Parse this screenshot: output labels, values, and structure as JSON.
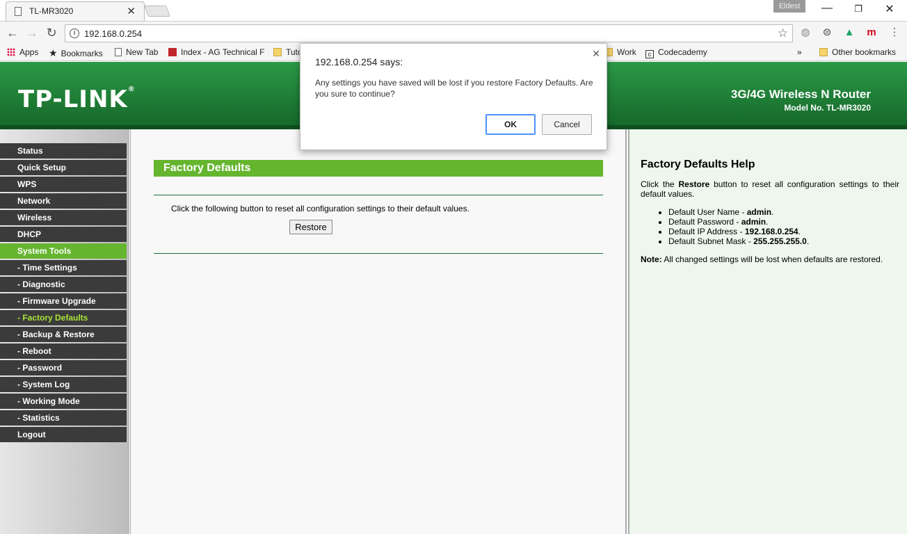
{
  "browser": {
    "tab_title": "TL-MR3020",
    "profile_name": "Eldest",
    "url": "192.168.0.254",
    "bookmarks": [
      {
        "label": "Apps",
        "icon": "apps-grid-icon"
      },
      {
        "label": "Bookmarks",
        "icon": "star-icon"
      },
      {
        "label": "New Tab",
        "icon": "page-icon"
      },
      {
        "label": "Index - AG Technical F",
        "icon": "site-icon"
      },
      {
        "label": "Tuto",
        "icon": "folder-icon"
      },
      {
        "label": "Work",
        "icon": "folder-icon"
      },
      {
        "label": "Codecademy",
        "icon": "codecademy-icon"
      }
    ],
    "overflow_label": "»",
    "other_bookmarks": "Other bookmarks"
  },
  "header": {
    "logo": "TP-LINK",
    "product_name": "3G/4G Wireless N Router",
    "model": "Model No. TL-MR3020"
  },
  "sidebar": {
    "items": [
      {
        "label": "Status"
      },
      {
        "label": "Quick Setup"
      },
      {
        "label": "WPS"
      },
      {
        "label": "Network"
      },
      {
        "label": "Wireless"
      },
      {
        "label": "DHCP"
      },
      {
        "label": "System Tools",
        "state": "active"
      },
      {
        "label": "- Time Settings"
      },
      {
        "label": "- Diagnostic"
      },
      {
        "label": "- Firmware Upgrade"
      },
      {
        "label": "- Factory Defaults",
        "state": "current"
      },
      {
        "label": "- Backup & Restore"
      },
      {
        "label": "- Reboot"
      },
      {
        "label": "- Password"
      },
      {
        "label": "- System Log"
      },
      {
        "label": "- Working Mode"
      },
      {
        "label": "- Statistics"
      },
      {
        "label": "Logout"
      }
    ]
  },
  "main": {
    "title": "Factory Defaults",
    "description": "Click the following button to reset all configuration settings to their default values.",
    "restore_label": "Restore"
  },
  "help": {
    "title": "Factory Defaults Help",
    "intro_pre": "Click the ",
    "intro_bold": "Restore",
    "intro_post": " button to reset all configuration settings to their default values.",
    "items": [
      {
        "label": "Default User Name - ",
        "value": "admin"
      },
      {
        "label": "Default Password - ",
        "value": "admin"
      },
      {
        "label": "Default IP Address - ",
        "value": "192.168.0.254"
      },
      {
        "label": "Default Subnet Mask - ",
        "value": "255.255.255.0"
      }
    ],
    "note_label": "Note:",
    "note_text": " All changed settings will be lost when defaults are restored."
  },
  "dialog": {
    "title": "192.168.0.254 says:",
    "message": "Any settings you have saved will be lost if you restore Factory Defaults. Are you sure to continue?",
    "ok_label": "OK",
    "cancel_label": "Cancel"
  },
  "colors": {
    "header_green": "#1d7a34",
    "menu_active": "#65b52f",
    "menu_bg": "#3b3b3b",
    "submenu_current": "#a9e63a"
  }
}
